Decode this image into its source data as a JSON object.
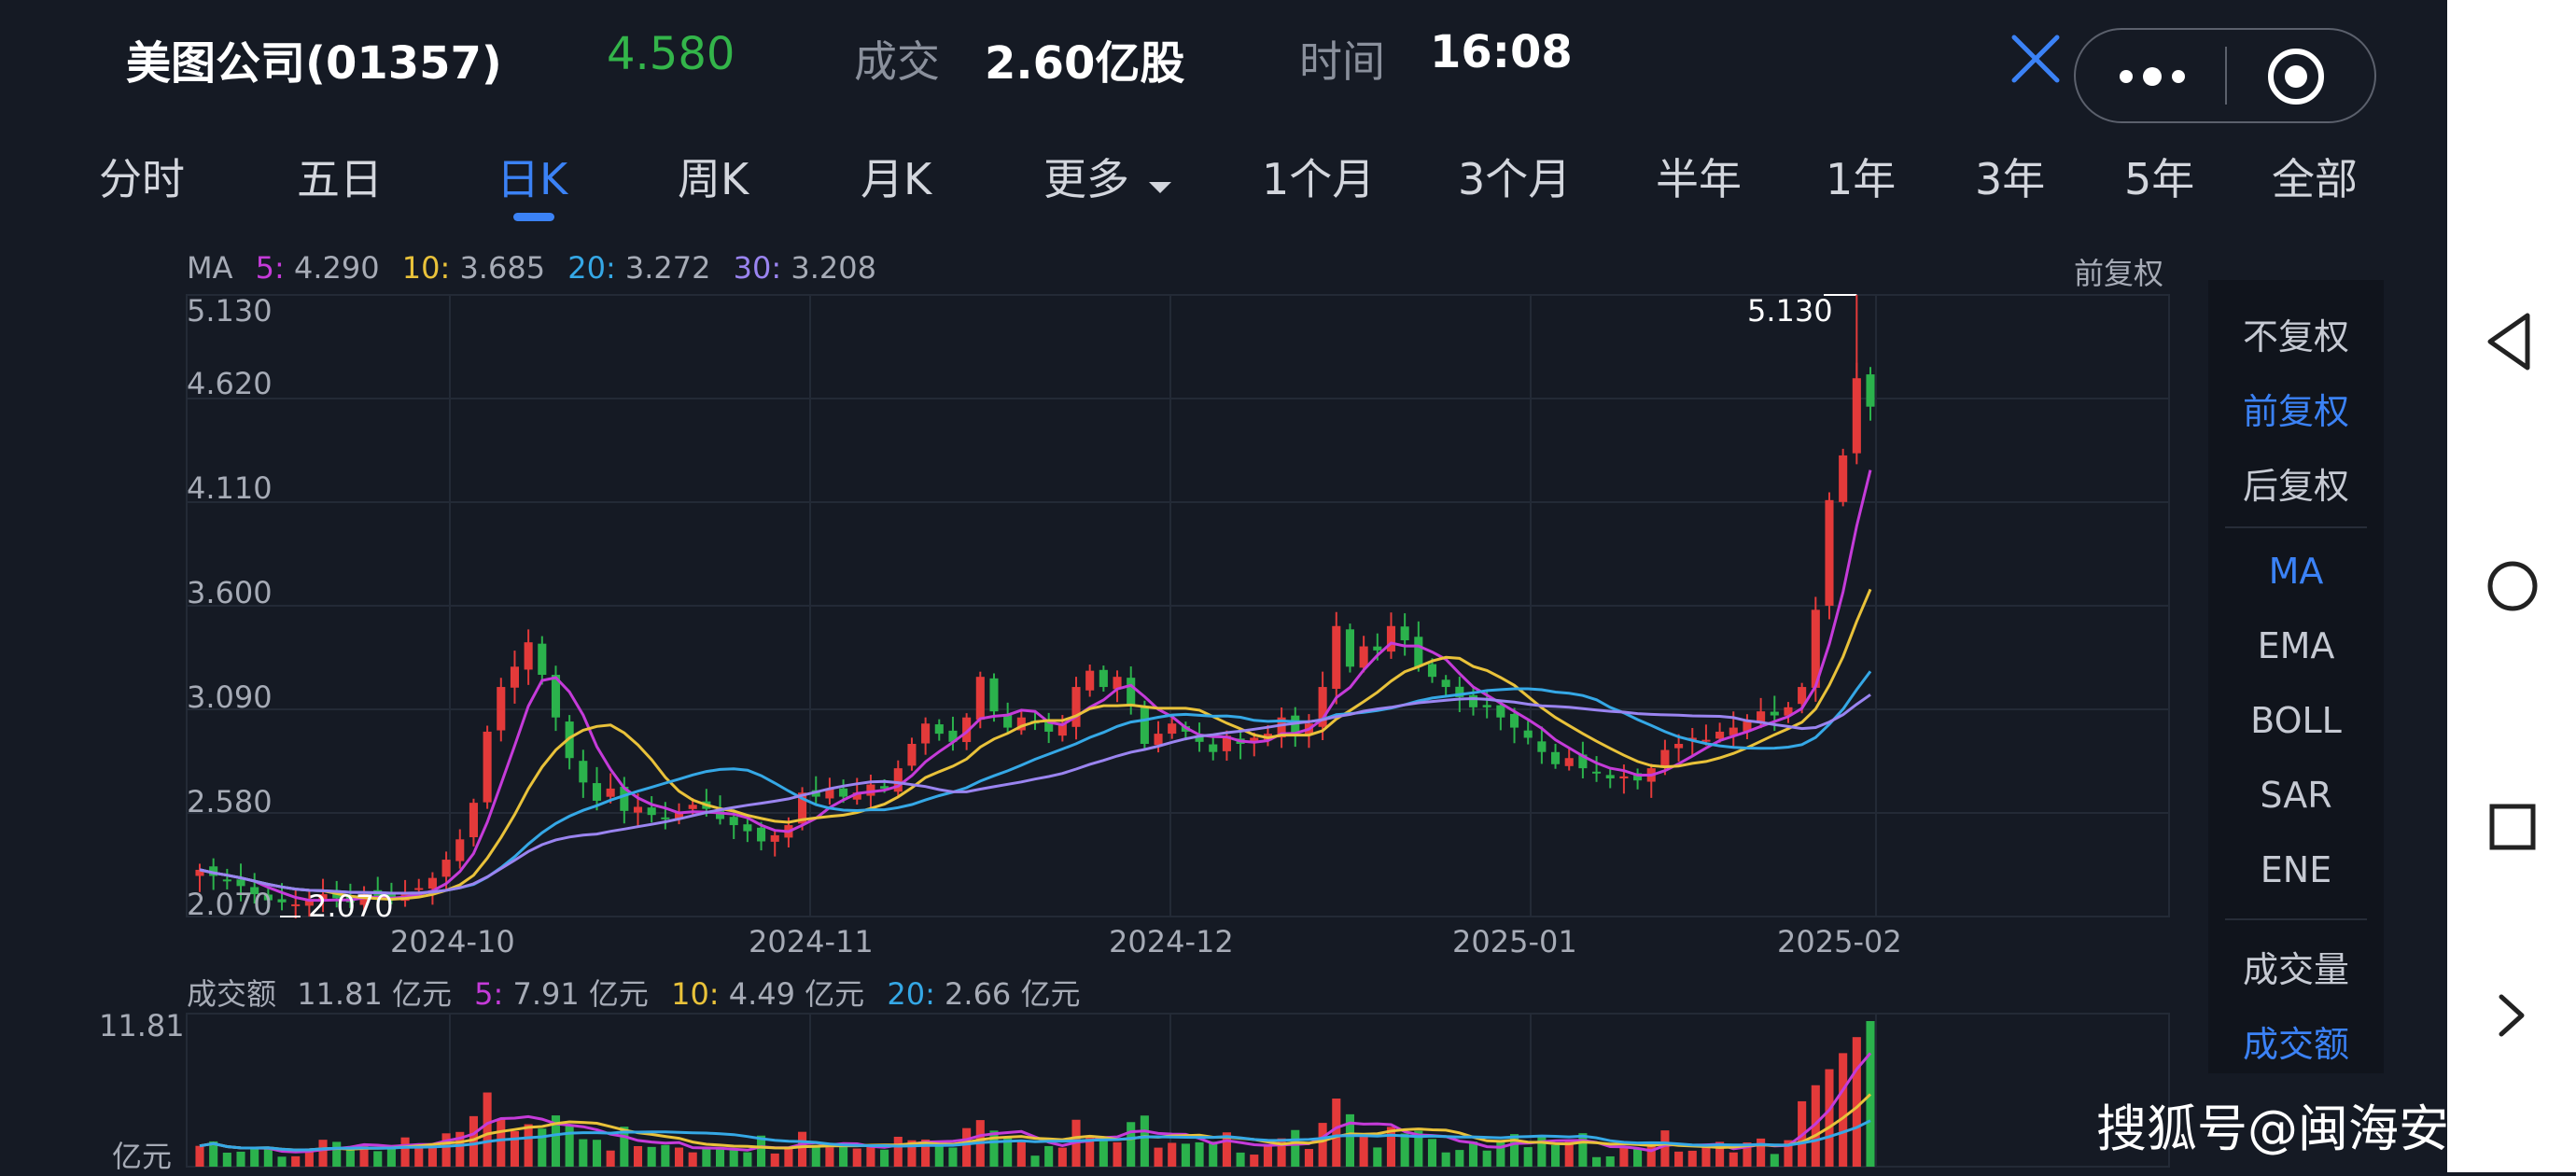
{
  "header": {
    "stock_name": "美图公司(01357)",
    "price": "4.580",
    "volume_label": "成交",
    "volume_value": "2.60亿股",
    "time_label": "时间",
    "time_value": "16:08"
  },
  "tabs": [
    {
      "label": "分时"
    },
    {
      "label": "五日"
    },
    {
      "label": "日K"
    },
    {
      "label": "周K"
    },
    {
      "label": "月K"
    },
    {
      "label": "更多"
    },
    {
      "label": "1个月"
    },
    {
      "label": "3个月"
    },
    {
      "label": "半年"
    },
    {
      "label": "1年"
    },
    {
      "label": "3年"
    },
    {
      "label": "5年"
    },
    {
      "label": "全部"
    }
  ],
  "active_tab": "日K",
  "icons": {
    "close": "close-icon",
    "more": "more-dots-icon",
    "target": "target-icon",
    "back": "back-triangle-icon",
    "home": "home-circle-icon",
    "recent": "recent-square-icon",
    "next": "chevron-right-icon"
  },
  "colors": {
    "up": "#e33a3a",
    "down": "#2bb24c",
    "accent": "#3b82f6",
    "ma5": "#c53bd9",
    "ma10": "#e9c23a",
    "ma20": "#35a8e6",
    "ma30": "#9a84f0",
    "background": "#151a24"
  },
  "price_chart": {
    "ma_label": "MA",
    "ma5_label": "5:",
    "ma5_value": "4.290",
    "ma10_label": "10:",
    "ma10_value": "3.685",
    "ma20_label": "20:",
    "ma20_value": "3.272",
    "ma30_label": "30:",
    "ma30_value": "3.208",
    "adjust_label": "前复权",
    "y_ticks": [
      "5.130",
      "4.620",
      "4.110",
      "3.600",
      "3.090",
      "2.580",
      "2.070"
    ],
    "x_ticks": [
      "2024-10",
      "2024-11",
      "2024-12",
      "2025-01",
      "2025-02"
    ],
    "max_label": "5.130",
    "min_label": "2.070"
  },
  "side_panel": {
    "adjust_options": [
      "不复权",
      "前复权",
      "后复权"
    ],
    "adjust_active": "前复权",
    "indicators": [
      "MA",
      "EMA",
      "BOLL",
      "SAR",
      "ENE"
    ],
    "indicator_active": "MA",
    "volume_options": [
      "成交量",
      "成交额"
    ],
    "volume_active": "成交额"
  },
  "volume_chart": {
    "title": "成交额",
    "value": "11.81 亿元",
    "ma5_label": "5:",
    "ma5_value": "7.91 亿元",
    "ma10_label": "10:",
    "ma10_value": "4.49 亿元",
    "ma20_label": "20:",
    "ma20_value": "2.66 亿元",
    "y_top": "11.81",
    "y_unit": "亿元"
  },
  "watermark": "搜狐号@闽海安澜",
  "chart_data": {
    "type": "candlestick",
    "x_ticks": [
      "2024-10",
      "2024-11",
      "2024-12",
      "2025-01",
      "2025-02"
    ],
    "ylim": [
      2.07,
      5.13
    ],
    "y_ticks": [
      5.13,
      4.62,
      4.11,
      3.6,
      3.09,
      2.58,
      2.07
    ],
    "series": [
      {
        "name": "5",
        "last": 4.29
      },
      {
        "name": "10",
        "last": 3.685
      },
      {
        "name": "20",
        "last": 3.272
      },
      {
        "name": "30",
        "last": 3.208
      }
    ],
    "closes": [
      2.3,
      2.27,
      2.25,
      2.22,
      2.18,
      2.15,
      2.14,
      2.13,
      2.15,
      2.18,
      2.16,
      2.14,
      2.18,
      2.17,
      2.15,
      2.19,
      2.21,
      2.26,
      2.35,
      2.45,
      2.63,
      2.98,
      3.2,
      3.3,
      3.42,
      3.26,
      3.05,
      2.85,
      2.73,
      2.64,
      2.7,
      2.59,
      2.61,
      2.57,
      2.55,
      2.58,
      2.62,
      2.6,
      2.55,
      2.52,
      2.49,
      2.44,
      2.47,
      2.52,
      2.68,
      2.66,
      2.7,
      2.66,
      2.68,
      2.72,
      2.7,
      2.8,
      2.92,
      3.02,
      2.97,
      2.93,
      3.05,
      3.25,
      3.08,
      3.0,
      3.05,
      3.02,
      2.98,
      3.02,
      3.2,
      3.28,
      3.2,
      3.25,
      3.11,
      2.92,
      2.97,
      3.02,
      2.98,
      2.93,
      2.88,
      2.96,
      2.92,
      2.95,
      2.97,
      3.05,
      2.97,
      3.02,
      3.2,
      3.5,
      3.3,
      3.4,
      3.38,
      3.5,
      3.43,
      3.3,
      3.25,
      3.2,
      3.15,
      3.1,
      3.1,
      3.05,
      3.0,
      2.95,
      2.88,
      2.82,
      2.85,
      2.8,
      2.78,
      2.75,
      2.76,
      2.74,
      2.8,
      2.89,
      2.92,
      2.95,
      2.94,
      2.98,
      3.0,
      3.03,
      3.08,
      3.06,
      3.1,
      3.2,
      3.58,
      4.12,
      4.34,
      4.72,
      4.58
    ],
    "volume_max_label": 11.81,
    "volume_last": 11.81
  }
}
